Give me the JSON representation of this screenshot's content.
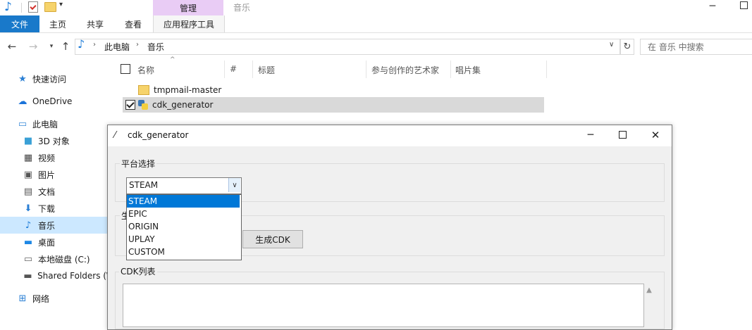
{
  "titlebar": {
    "context_tab": "管理",
    "title": "音乐"
  },
  "ribbon": {
    "tabs": [
      "文件",
      "主页",
      "共享",
      "查看",
      "应用程序工具"
    ]
  },
  "address": {
    "segments": [
      "此电脑",
      "音乐"
    ],
    "search_placeholder": "在 音乐 中搜索"
  },
  "nav": {
    "items": [
      {
        "label": "快速访问",
        "icon": "star-icon"
      },
      {
        "label": "OneDrive",
        "icon": "cloud-icon"
      },
      {
        "label": "此电脑",
        "icon": "computer-icon"
      },
      {
        "label": "3D 对象",
        "icon": "cube-icon"
      },
      {
        "label": "视频",
        "icon": "film-icon"
      },
      {
        "label": "图片",
        "icon": "picture-icon"
      },
      {
        "label": "文档",
        "icon": "document-icon"
      },
      {
        "label": "下载",
        "icon": "download-icon"
      },
      {
        "label": "音乐",
        "icon": "music-icon"
      },
      {
        "label": "桌面",
        "icon": "desktop-icon"
      },
      {
        "label": "本地磁盘 (C:)",
        "icon": "drive-icon"
      },
      {
        "label": "Shared Folders (\\",
        "icon": "network-drive-icon"
      },
      {
        "label": "网络",
        "icon": "network-icon"
      }
    ]
  },
  "columns": [
    "名称",
    "#",
    "标题",
    "参与创作的艺术家",
    "唱片集"
  ],
  "files": [
    {
      "name": "tmpmail-master",
      "type": "folder",
      "checked": false
    },
    {
      "name": "cdk_generator",
      "type": "python",
      "checked": true
    }
  ],
  "app": {
    "title": "cdk_generator",
    "platform_group": "平台选择",
    "generate_group": "生",
    "list_group": "CDK列表",
    "combo_value": "STEAM",
    "options": [
      "STEAM",
      "EPIC",
      "ORIGIN",
      "UPLAY",
      "CUSTOM"
    ],
    "generate_button": "生成CDK"
  },
  "colors": {
    "accent": "#1979ca",
    "selection": "#0078d7",
    "context_tab": "#e9ccf5"
  }
}
